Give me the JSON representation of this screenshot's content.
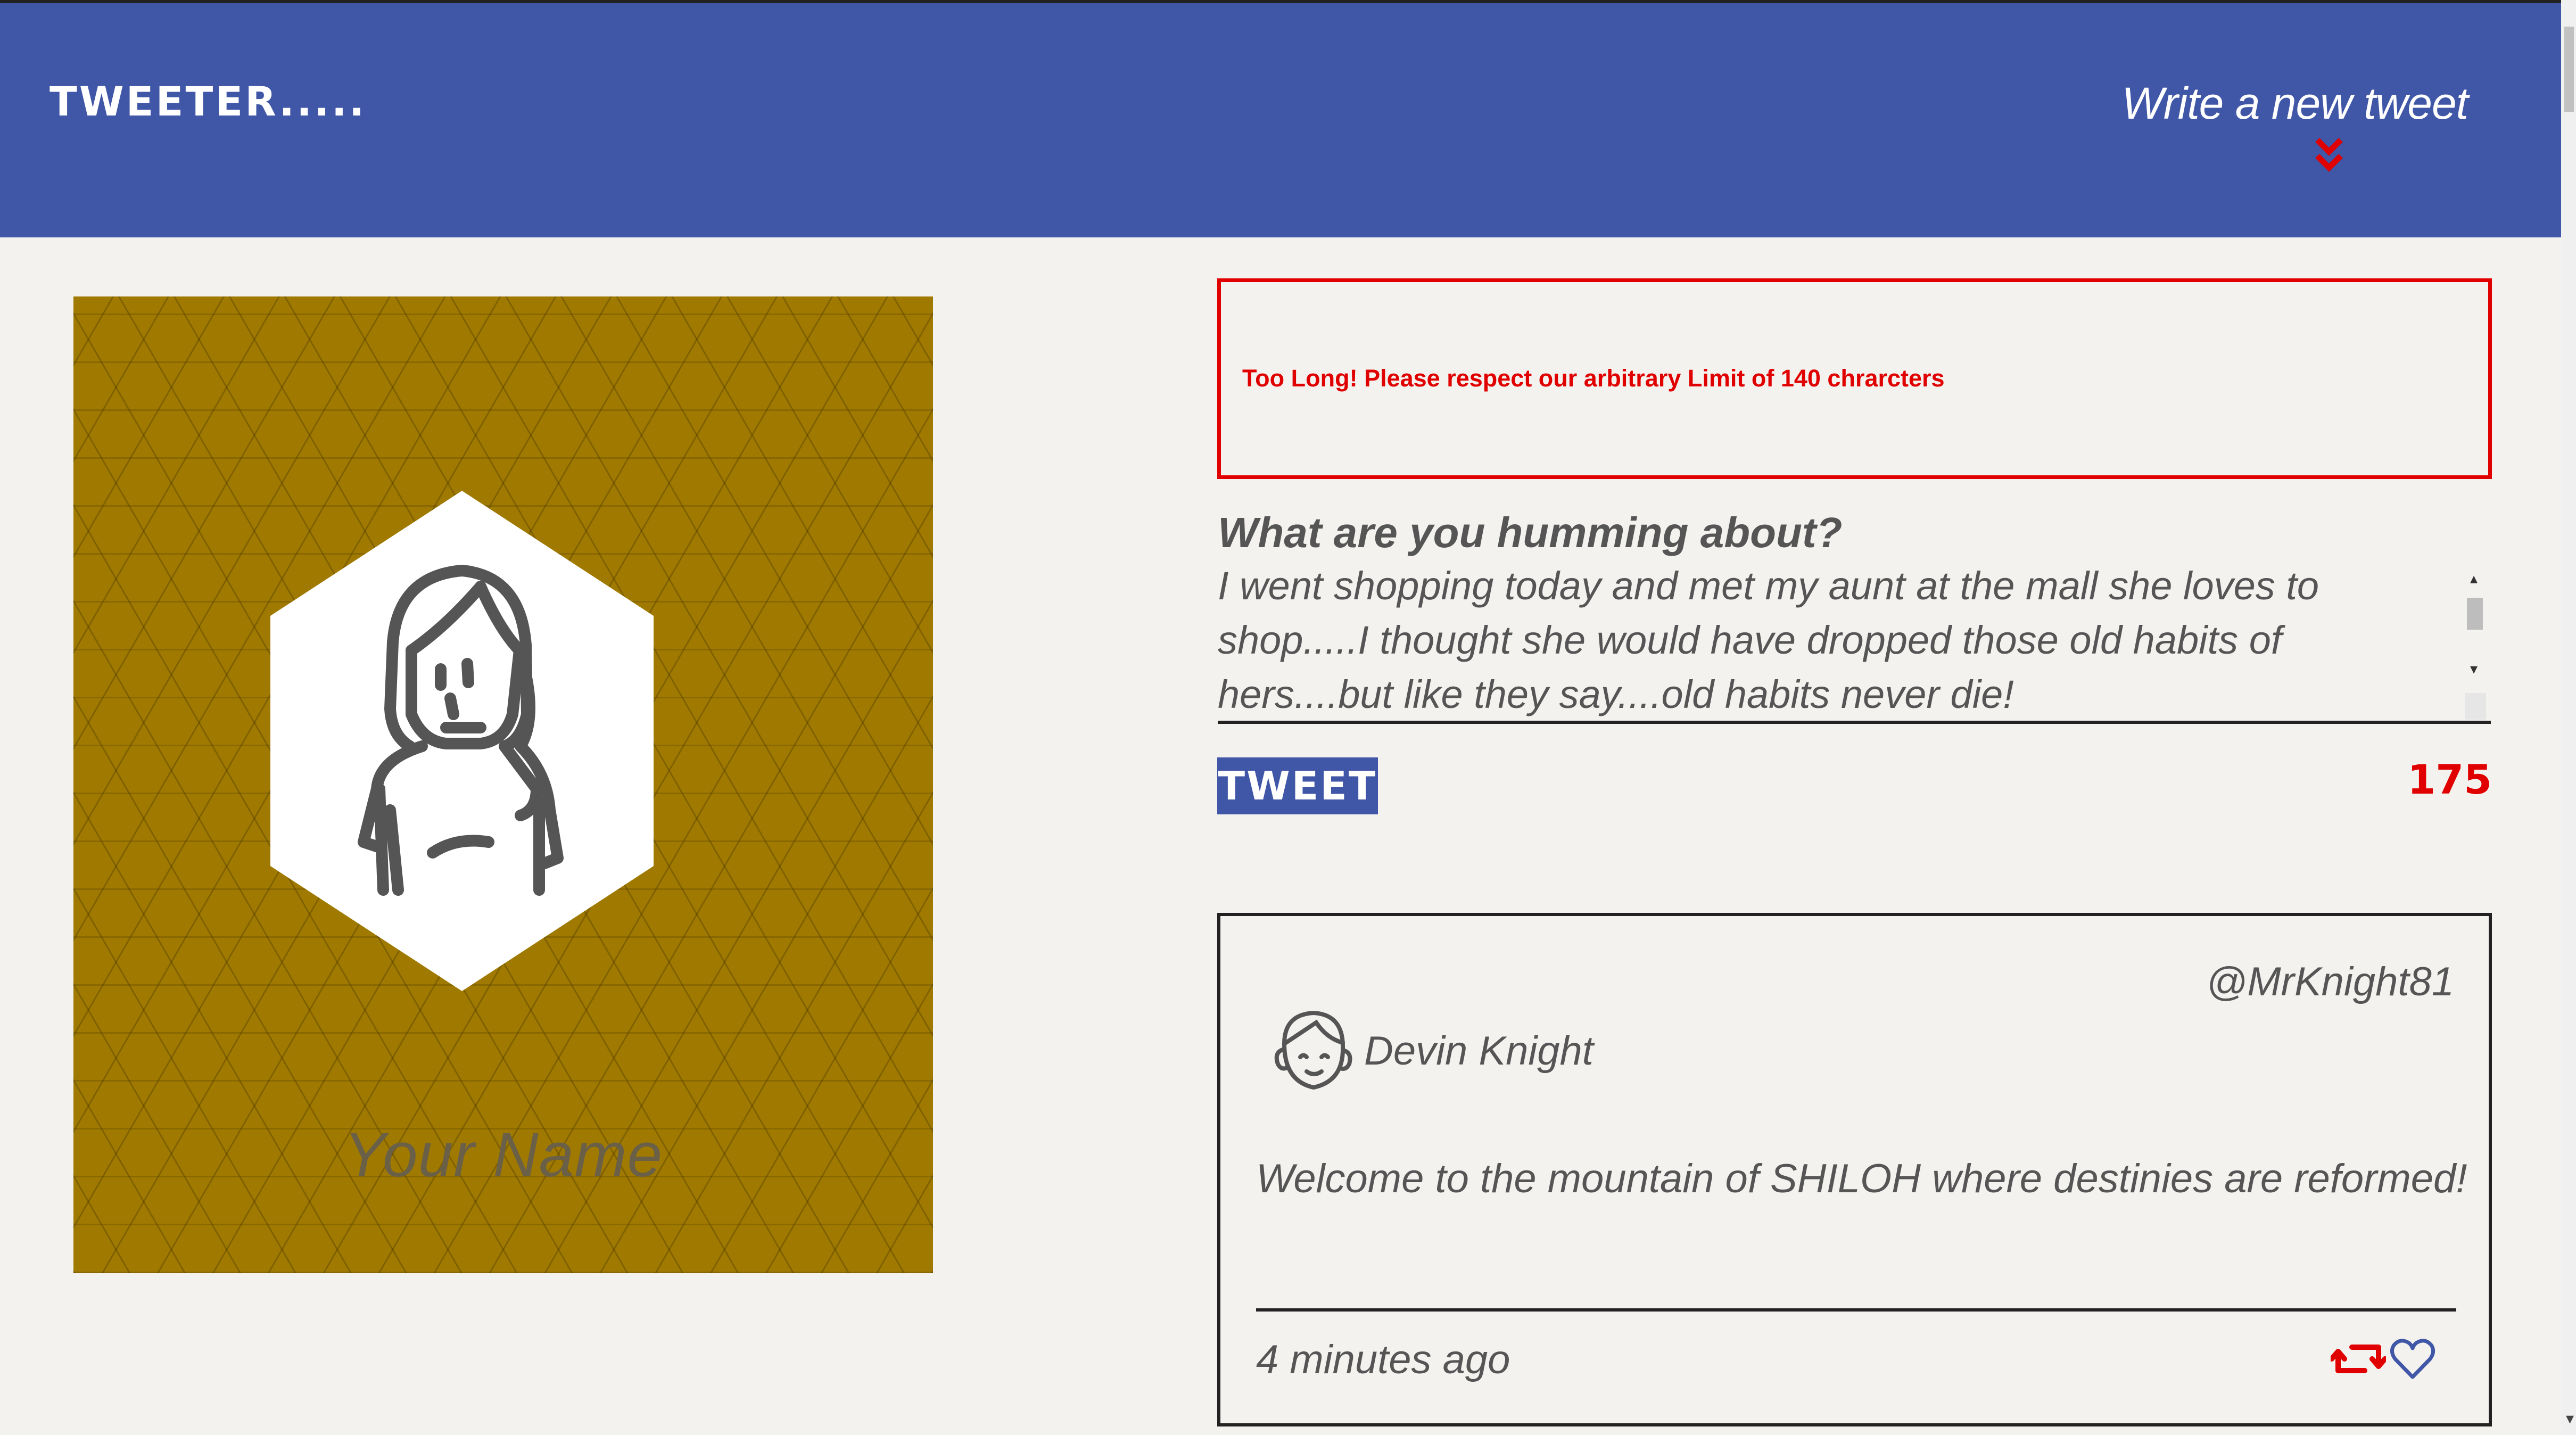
{
  "header": {
    "brand": "TWEETER.....",
    "compose_link": "Write a new tweet"
  },
  "profile": {
    "name": "Your Name"
  },
  "compose": {
    "error_message": "Too Long! Please respect our arbitrary Limit of 140 chrarcters",
    "label": "What are you humming about?",
    "text": "I went shopping today and met my aunt at the mall she loves to shop.....I thought she would have dropped those old habits of hers....but like they say....old habits never die!",
    "button_label": "TWEET",
    "counter": "175"
  },
  "tweet": {
    "handle": "@MrKnight81",
    "author": "Devin Knight",
    "body": "Welcome to the mountain of SHILOH where destinies are reformed!",
    "time": "4 minutes ago"
  },
  "icons": {
    "compose_chevron": "double-chevron-down-icon",
    "retweet": "retweet-icon",
    "like": "heart-icon"
  },
  "colors": {
    "nav": "#4056a6",
    "error": "#e00000",
    "profile_bg": "#a07a00",
    "page_bg": "#f4f2ef"
  }
}
